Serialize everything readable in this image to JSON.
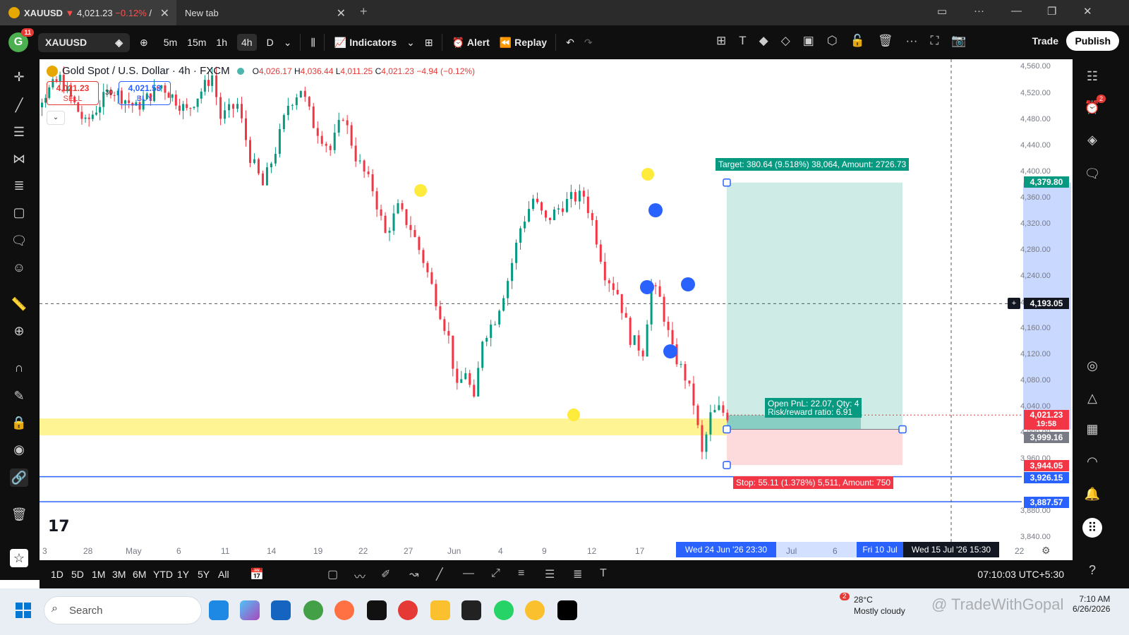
{
  "browser": {
    "tab1": {
      "symbol": "XAUUSD",
      "arrow": "▼",
      "price": "4,021.23",
      "change": "−0.12%",
      "sep": "/"
    },
    "tab2": {
      "title": "New tab"
    }
  },
  "toolbar": {
    "avatar_letter": "G",
    "avatar_badge": "11",
    "symbol": "XAUUSD",
    "intervals": [
      "5m",
      "15m",
      "1h",
      "4h",
      "D"
    ],
    "active_interval": "4h",
    "indicators_label": "Indicators",
    "alert_label": "Alert",
    "replay_label": "Replay",
    "trade_label": "Trade",
    "publish_label": "Publish"
  },
  "legend": {
    "title": "Gold Spot / U.S. Dollar · 4h · FXCM",
    "ohlc": [
      {
        "k": "O",
        "v": "4,026.17"
      },
      {
        "k": "H",
        "v": "4,036.44"
      },
      {
        "k": "L",
        "v": "4,011.25"
      },
      {
        "k": "C",
        "v": "4,021.23"
      }
    ],
    "change": "−4.94 (−0.12%)",
    "sell_price": "4,021.23",
    "sell_label": "SELL",
    "buy_price": "4,021.53",
    "buy_label": "BUY",
    "spread": "30"
  },
  "price_axis": {
    "labels": [
      "4,560.00",
      "4,520.00",
      "4,480.00",
      "4,440.00",
      "4,400.00",
      "4,360.00",
      "4,320.00",
      "4,280.00",
      "4,240.00",
      "4,200.00",
      "4,160.00",
      "4,120.00",
      "4,080.00",
      "4,040.00",
      "4,000.00",
      "3,960.00",
      "3,880.00",
      "3,840.00"
    ],
    "tags": {
      "target": "4,379.80",
      "crosshair": "4,193.05",
      "last_price": "4,021.23",
      "countdown": "19:58",
      "entry": "3,999.16",
      "stop": "3,944.05",
      "line1": "3,926.15",
      "line2": "3,887.57"
    }
  },
  "time_axis": {
    "labels": [
      "3",
      "28",
      "May",
      "6",
      "11",
      "14",
      "19",
      "22",
      "27",
      "Jun",
      "4",
      "9",
      "12",
      "17",
      "Jul",
      "6",
      "22"
    ],
    "tags": {
      "start": "Wed 24 Jun '26   23:30",
      "end": "Fri 10 Jul",
      "cursor": "Wed 15 Jul '26   15:30"
    }
  },
  "position": {
    "target_label": "Target: 380.64 (9.518%) 38,064, Amount: 2726.73",
    "pnl_label": "Open PnL: 22.07, Qty: 4",
    "rr_label": "Risk/reward ratio: 6.91",
    "stop_label": "Stop: 55.11 (1.378%) 5,511, Amount: 750"
  },
  "chart_data": {
    "type": "candlestick",
    "symbol": "XAUUSD",
    "timeframe": "4h",
    "y_range": [
      3830,
      4570
    ],
    "key_levels": {
      "target": 4379.8,
      "entry": 3999.16,
      "stop": 3944.05,
      "support_1": 3926.15,
      "support_2": 3887.57,
      "last": 4021.23,
      "crosshair": 4193.05
    },
    "price_path": [
      [
        0.24,
        4520
      ],
      [
        0.27,
        4500
      ],
      [
        0.3,
        4540
      ],
      [
        0.33,
        4470
      ],
      [
        0.36,
        4525
      ],
      [
        0.39,
        4495
      ],
      [
        0.42,
        4530
      ],
      [
        0.45,
        4490
      ],
      [
        0.48,
        4545
      ],
      [
        0.49,
        4480
      ],
      [
        0.51,
        4500
      ],
      [
        0.525,
        4420
      ],
      [
        0.54,
        4375
      ],
      [
        0.555,
        4430
      ],
      [
        0.57,
        4500
      ],
      [
        0.585,
        4525
      ],
      [
        0.6,
        4470
      ],
      [
        0.62,
        4430
      ],
      [
        0.635,
        4485
      ],
      [
        0.65,
        4420
      ],
      [
        0.67,
        4370
      ],
      [
        0.685,
        4300
      ],
      [
        0.7,
        4340
      ],
      [
        0.715,
        4310
      ],
      [
        0.73,
        4260
      ],
      [
        0.745,
        4200
      ],
      [
        0.76,
        4140
      ],
      [
        0.77,
        4060
      ],
      [
        0.78,
        4090
      ],
      [
        0.79,
        4040
      ],
      [
        0.8,
        4140
      ],
      [
        0.815,
        4170
      ],
      [
        0.83,
        4230
      ],
      [
        0.845,
        4310
      ],
      [
        0.86,
        4355
      ],
      [
        0.875,
        4320
      ],
      [
        0.89,
        4340
      ],
      [
        0.905,
        4355
      ],
      [
        0.92,
        4360
      ],
      [
        0.93,
        4320
      ],
      [
        0.945,
        4240
      ],
      [
        0.96,
        4210
      ],
      [
        0.975,
        4140
      ],
      [
        0.99,
        4120
      ],
      [
        1.0,
        4220
      ],
      [
        1.01,
        4200
      ],
      [
        1.025,
        4120
      ],
      [
        1.04,
        4080
      ],
      [
        1.05,
        4040
      ],
      [
        1.06,
        3960
      ],
      [
        1.07,
        4020
      ],
      [
        1.08,
        4030
      ],
      [
        1.09,
        4021
      ]
    ]
  },
  "bottombar": {
    "ranges": [
      "1D",
      "5D",
      "1M",
      "3M",
      "6M",
      "YTD",
      "1Y",
      "5Y",
      "All"
    ],
    "clock": "07:10:03 UTC+5:30"
  },
  "taskbar": {
    "search_label": "Search",
    "weather_temp": "28°C",
    "weather_desc": "Mostly cloudy",
    "weather_badge": "2",
    "watermark": "@ TradeWithGopal",
    "time": "7:10 AM",
    "date": "6/26/2026"
  },
  "colors": {
    "up": "#089981",
    "down": "#f23645",
    "target_zone": "rgba(8,153,129,0.2)",
    "stop_zone": "rgba(242,54,69,0.18)",
    "support_zone": "rgba(255,235,59,0.55)",
    "marker_blue": "#2962ff",
    "marker_yellow": "#ffeb3b"
  }
}
